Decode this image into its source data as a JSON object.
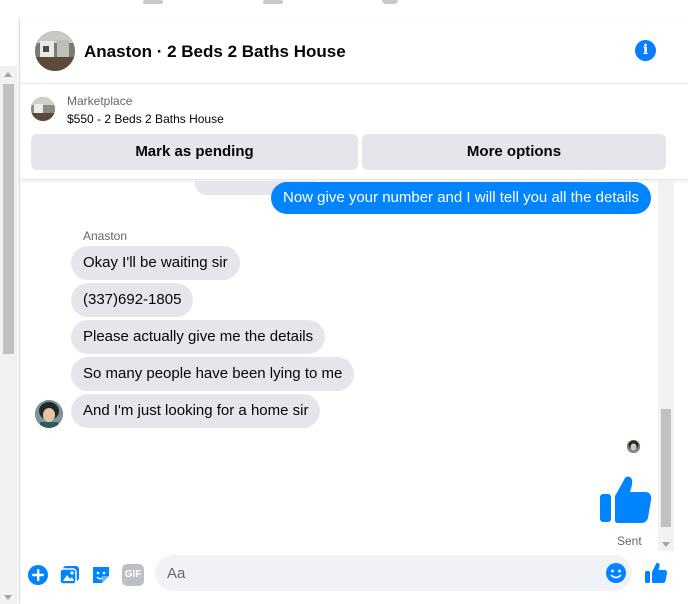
{
  "header": {
    "title": "Anaston · 2 Beds 2 Baths House"
  },
  "listing": {
    "label": "Marketplace",
    "price_title": "$550 - 2 Beds 2 Baths House",
    "pending_button": "Mark as pending",
    "more_button": "More options"
  },
  "messages": {
    "sent": [
      "Now give your number and I will tell you all the details"
    ],
    "sender_name": "Anaston",
    "received": [
      "Okay I'll be waiting sir",
      "(337)692-1805",
      "Please actually give me the details",
      "So many people have been lying to me",
      "And I'm just looking for a home sir"
    ],
    "status": "Sent"
  },
  "composer": {
    "placeholder": "Aa",
    "gif_label": "GIF"
  },
  "colors": {
    "accent": "#0084ff",
    "icon_blue": "#0a7cff",
    "bubble_gray": "#e4e6eb",
    "secondary_text": "#65676b"
  },
  "icons": [
    "info-icon",
    "plus-icon",
    "photo-icon",
    "sticker-icon",
    "gif-icon",
    "emoji-icon",
    "thumbs-up-icon"
  ]
}
